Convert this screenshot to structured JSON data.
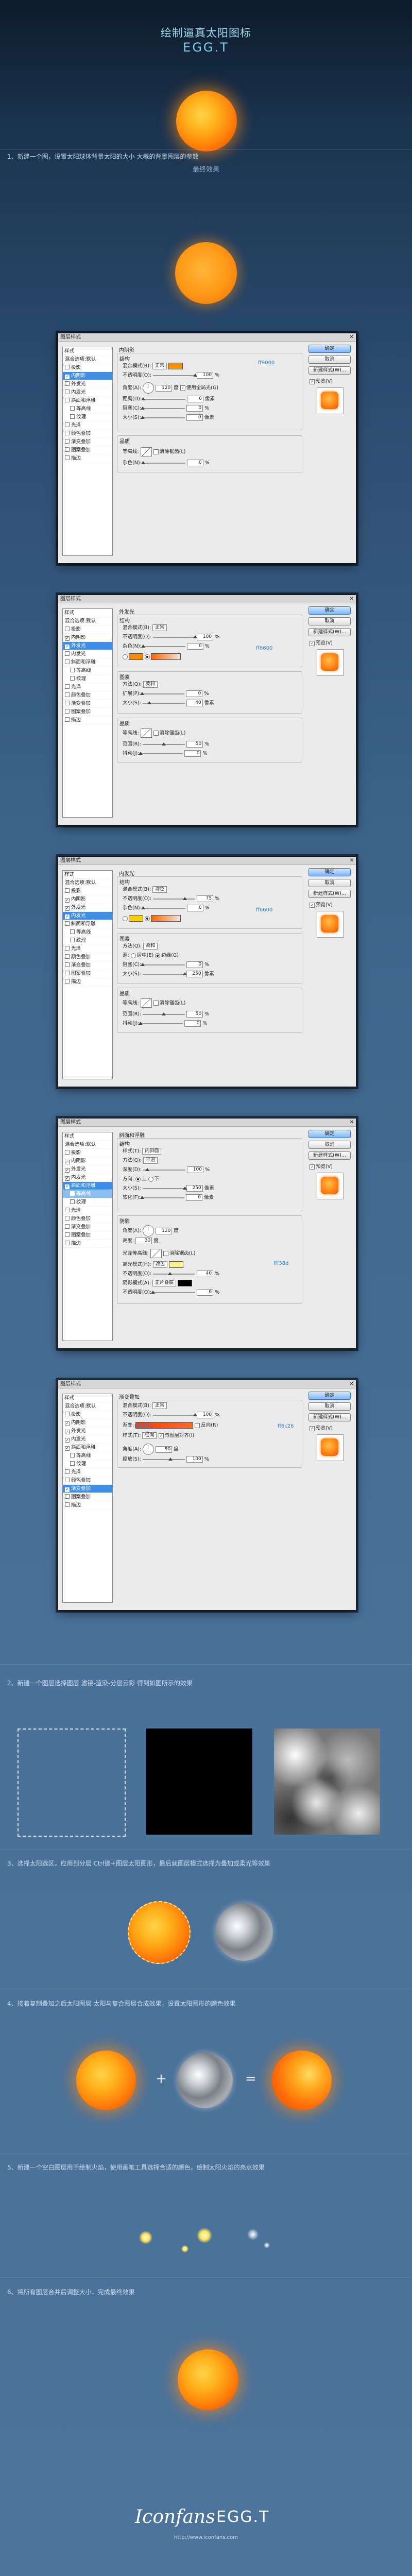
{
  "header": {
    "title_cn": "绘制逼真太阳图标",
    "title_en": "EGG.T",
    "final_caption": "最终效果"
  },
  "steps": {
    "step1": "1、新建一个图，设置太阳球体背景太阳的大小 大概的背景图层的参数",
    "step2": "2、新建一个图层选择图层 滤镜-渲染-分层云彩 得到如图所示的效果",
    "step3": "3、选择太阳选区，应用到分层 Ctrl键+图层太阳图形，最后就图层模式选择为叠加或柔光等效果",
    "step4": "4、接着复制叠加之后太阳图层 太阳与复合图层合成效果，设置太阳图形的颜色效果",
    "step5": "5、新建一个空白图层用于绘制火焰，使用画笔工具选择合适的颜色，绘制太阳火焰的亮点效果",
    "step6": "6、将所有图层合并后调整大小，完成最终效果"
  },
  "dialog": {
    "title": "图层样式",
    "close": "✕",
    "styles_header": "样式",
    "blend_options": "混合选项:默认",
    "layer_items": [
      {
        "label": "投影",
        "indent": false,
        "checked": false
      },
      {
        "label": "内阴影",
        "indent": false,
        "checked": false
      },
      {
        "label": "外发光",
        "indent": false,
        "checked": false
      },
      {
        "label": "内发光",
        "indent": false,
        "checked": false
      },
      {
        "label": "斜面和浮雕",
        "indent": false,
        "checked": false
      },
      {
        "label": "等高线",
        "indent": true,
        "checked": false
      },
      {
        "label": "纹理",
        "indent": true,
        "checked": false
      },
      {
        "label": "光泽",
        "indent": false,
        "checked": false
      },
      {
        "label": "颜色叠加",
        "indent": false,
        "checked": false
      },
      {
        "label": "渐变叠加",
        "indent": false,
        "checked": false
      },
      {
        "label": "图案叠加",
        "indent": false,
        "checked": false
      },
      {
        "label": "描边",
        "indent": false,
        "checked": false
      }
    ],
    "buttons": {
      "ok": "确定",
      "cancel": "取消",
      "new_style": "新建样式(W)...",
      "preview": "预览(V)"
    },
    "labels": {
      "structure": "结构",
      "blend_mode": "混合模式(B):",
      "opacity": "不透明度(O):",
      "noise": "杂色(N):",
      "elements": "图素",
      "method": "方法(Q):",
      "spread": "扩展(P):",
      "size": "大小(S):",
      "quality": "品质",
      "contour": "等高线:",
      "antialias": "消除锯齿(L)",
      "range": "范围(R):",
      "jitter": "抖动(J):",
      "angle": "角度(A):",
      "global_light": "使用全局光(G)",
      "distance": "距离(D):",
      "choke": "阻塞(C):",
      "style": "样式(T):",
      "depth": "深度(D):",
      "direction": "方向:",
      "up": "上",
      "down": "下",
      "soften": "软化(F):",
      "shading": "阴影",
      "altitude": "高度:",
      "gloss": "光泽等高线:",
      "highlight": "高光模式(H):",
      "shadow_mode": "阴影模式(A):",
      "gradient": "渐变:",
      "reverse": "反向(R)",
      "align": "与图层对齐(I)",
      "scale": "缩放(S):",
      "source": "源:",
      "center": "居中(E)",
      "edge": "边缘(G)"
    },
    "d1": {
      "section": "内阴影",
      "selected": "内阴影",
      "blend": "正常",
      "color": "#ff9000",
      "hex": "ff9000",
      "opacity": "100",
      "angle": "120",
      "distance": "0",
      "choke": "0",
      "size": "0",
      "noise": "0",
      "unit_pct": "%",
      "unit_px": "像素",
      "unit_deg": "度"
    },
    "d2": {
      "section": "外发光",
      "selected": "外发光",
      "blend": "正常",
      "opacity": "100",
      "noise": "0",
      "grad_hex": "ff6600",
      "method": "柔和",
      "spread": "0",
      "size": "40",
      "range": "50",
      "jitter": "0"
    },
    "d3": {
      "section": "内发光",
      "selected": "内发光",
      "blend": "滤色",
      "opacity": "75",
      "noise": "0",
      "grad_hex": "ff6600",
      "method": "柔和",
      "choke": "0",
      "size": "250",
      "range": "50",
      "jitter": "0"
    },
    "d4": {
      "section": "斜面和浮雕",
      "selected": "斜面和浮雕",
      "style": "内斜面",
      "method": "平滑",
      "depth": "100",
      "size": "250",
      "soften": "0",
      "angle": "120",
      "altitude": "30",
      "highlight": "滤色",
      "hl_hex": "fff38d",
      "hl_opacity": "40",
      "shadow": "正片叠底",
      "shadow_opacity": "0"
    },
    "d5": {
      "section": "渐变叠加",
      "selected": "渐变叠加",
      "blend": "正常",
      "opacity": "100",
      "left_hex": "ff3c00",
      "right_hex": "ff6c26",
      "style": "径向",
      "angle": "90",
      "scale": "100"
    }
  },
  "footer": {
    "logo_left": "Iconfans",
    "logo_right": "EGG.T",
    "url": "http://www.iconfans.com"
  }
}
